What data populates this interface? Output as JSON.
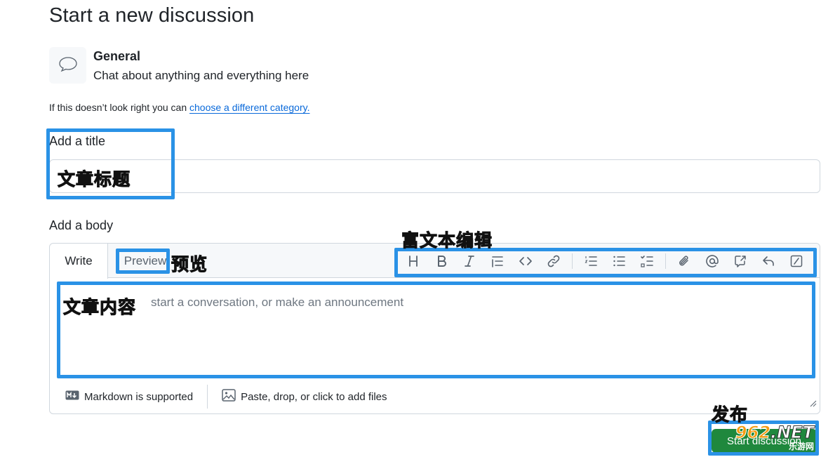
{
  "page": {
    "title": "Start a new discussion"
  },
  "category": {
    "name": "General",
    "description": "Chat about anything and everything here",
    "icon": "comment-icon",
    "note_prefix": "If this doesn’t look right you can",
    "note_link": "choose a different category."
  },
  "title_field": {
    "label": "Add a title",
    "value": ""
  },
  "body_field": {
    "label": "Add a body",
    "placeholder": "start a conversation, or make an announcement",
    "tabs": [
      "Write",
      "Preview"
    ],
    "active_tab": "Write",
    "toolbar": [
      "heading-icon",
      "bold-icon",
      "italic-icon",
      "quote-icon",
      "code-icon",
      "link-icon",
      "ordered-list-icon",
      "unordered-list-icon",
      "task-list-icon",
      "attach-icon",
      "mention-icon",
      "cross-reference-icon",
      "reply-icon",
      "slash-command-icon"
    ],
    "footer_markdown": "Markdown is supported",
    "footer_files": "Paste, drop, or click to add files"
  },
  "submit": {
    "label": "Start discussion"
  },
  "annotations": {
    "title": "文章标题",
    "preview": "预览",
    "toolbar": "富文本编辑",
    "body": "文章内容",
    "publish": "发布"
  },
  "watermark": {
    "main_accent": "962",
    "main_rest": ".NET",
    "sub": "乐游网"
  },
  "colors": {
    "accent_annotation": "#2a92e6",
    "link": "#0969da",
    "submit": "#1f883d"
  }
}
